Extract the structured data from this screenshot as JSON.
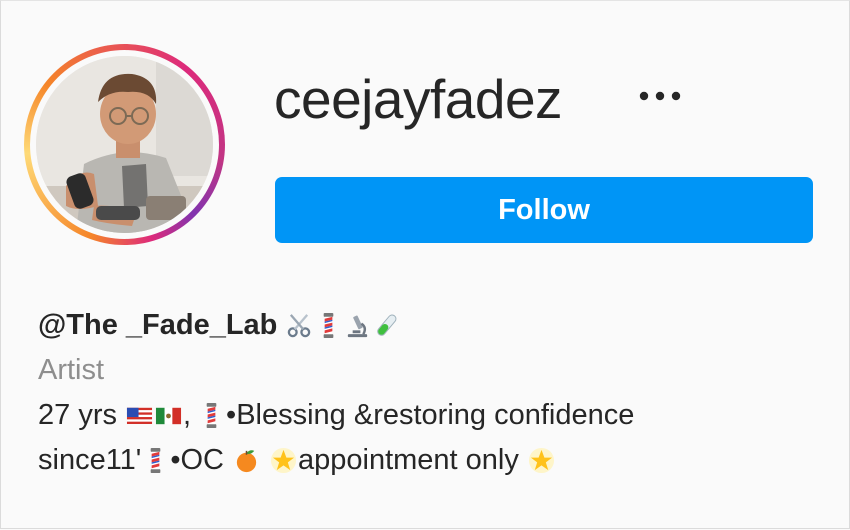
{
  "profile": {
    "username": "ceejayfadez",
    "more_options_icon": "more-horizontal-icon",
    "follow_label": "Follow",
    "accent_color": "#0095f6",
    "avatar_description_icon": "profile-avatar"
  },
  "bio": {
    "name": "@The _Fade_Lab",
    "name_emojis": [
      "scissors-icon",
      "barber-pole-icon",
      "microscope-icon",
      "test-tube-icon"
    ],
    "category": "Artist",
    "line1": {
      "a": "27 yrs",
      "b": ",",
      "c": "•Blessing &restoring confidence"
    },
    "line2": {
      "a": "since11'",
      "b": "•OC",
      "c": "appointment only"
    },
    "line1_emojis": [
      "us-flag-icon",
      "mexico-flag-icon",
      "barber-pole-icon"
    ],
    "line2_emojis": [
      "barber-pole-icon",
      "orange-icon",
      "glowing-star-icon",
      "glowing-star-icon"
    ]
  }
}
